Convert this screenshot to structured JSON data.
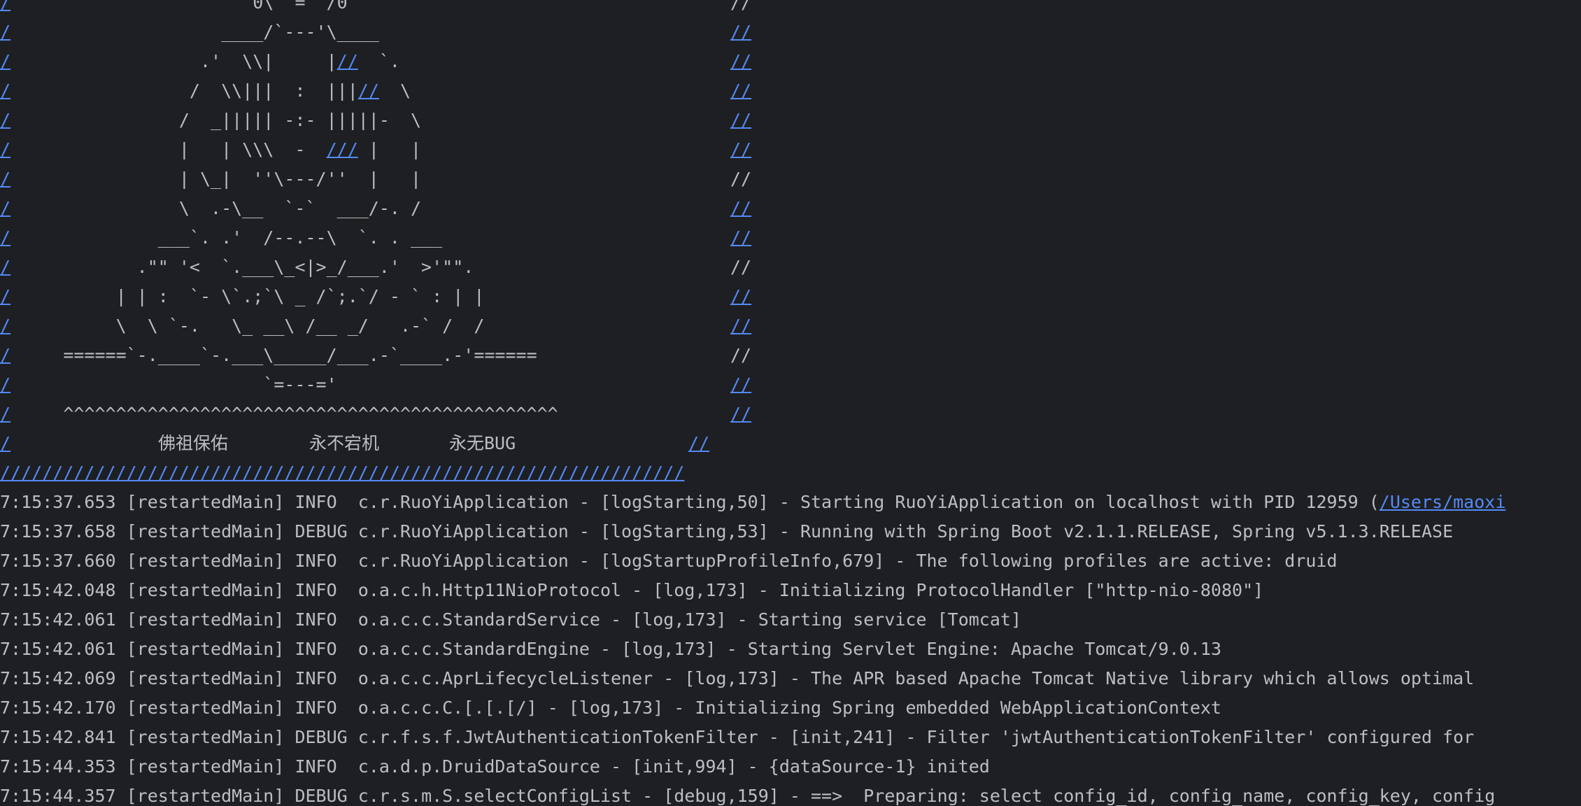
{
  "colors": {
    "background": "#1e1f22",
    "text": "#bcbec4",
    "link": "#548af7"
  },
  "banner": {
    "lines": [
      {
        "prefix": "/",
        "art": "                  0\\  =  /0                   ",
        "suffix": "//",
        "suffix_link": false,
        "prefix_link": true
      },
      {
        "prefix": "/",
        "art": "               ____/`---'\\____               ",
        "suffix": "//",
        "suffix_link": true,
        "prefix_link": true
      },
      {
        "prefix": "/",
        "art": "             .'  \\\\|     |",
        "mid_link": "//",
        "art_after": "  `.             ",
        "suffix": "//",
        "suffix_link": true,
        "prefix_link": true
      },
      {
        "prefix": "/",
        "art": "            /  \\\\|||  :  |||",
        "mid_link": "//",
        "art_after": "  \\            ",
        "suffix": "//",
        "suffix_link": true,
        "prefix_link": true
      },
      {
        "prefix": "/",
        "art": "           /  _||||| -:- |||||-  \\           ",
        "suffix": "//",
        "suffix_link": true,
        "prefix_link": true
      },
      {
        "prefix": "/",
        "art": "           |   | \\\\\\  -  ",
        "mid_link": "///",
        "art_after": " |   |           ",
        "suffix": "//",
        "suffix_link": true,
        "prefix_link": true
      },
      {
        "prefix": "/",
        "art": "           | \\_|  ''\\---/''  |   |           ",
        "suffix": "//",
        "suffix_link": false,
        "prefix_link": true
      },
      {
        "prefix": "/",
        "art": "           \\  .-\\__  `-`  ___/-. /           ",
        "suffix": "//",
        "suffix_link": true,
        "prefix_link": true
      },
      {
        "prefix": "/",
        "art": "         ___`. .'  /--.--\\  `. . ___         ",
        "suffix": "//",
        "suffix_link": true,
        "prefix_link": true
      },
      {
        "prefix": "/",
        "art": "       .\"\" '<  `.___\\_<|>_/___.'  >'\"\".       ",
        "suffix": "//",
        "suffix_link": false,
        "prefix_link": true
      },
      {
        "prefix": "/",
        "art": "     | | :  `- \\`.;`\\ _ /`;.`/ - ` : | |     ",
        "suffix": "//",
        "suffix_link": true,
        "prefix_link": true
      },
      {
        "prefix": "/",
        "art": "     \\  \\ `-.   \\_ __\\ /__ _/   .-` /  /     ",
        "suffix": "//",
        "suffix_link": true,
        "prefix_link": true
      },
      {
        "prefix": "/",
        "art": "======`-.____`-.___\\_____/___.-`____.-'======",
        "suffix": "//",
        "suffix_link": false,
        "prefix_link": true
      },
      {
        "prefix": "/",
        "art": "                   `=---='                    ",
        "suffix": "//",
        "suffix_link": true,
        "prefix_link": true
      },
      {
        "prefix": "/",
        "art": "^^^^^^^^^^^^^^^^^^^^^^^^^^^^^^^^^^^^^^^^^^^^^^^",
        "suffix": "//",
        "suffix_link": true,
        "prefix_link": true
      }
    ],
    "blessing": {
      "prefix": "/",
      "words": [
        "佛祖保佑",
        "永不宕机",
        "永无BUG"
      ],
      "suffix": "//"
    },
    "border": "/////////////////////////////////////////////////////////////////"
  },
  "log": [
    {
      "time": "7:15:37.653",
      "thread": "[restartedMain]",
      "level": "INFO ",
      "logger": "c.r.RuoYiApplication",
      "method": "[logStarting,50]",
      "message": "Starting RuoYiApplication on localhost with PID 12959 (",
      "link": "/Users/maoxi"
    },
    {
      "time": "7:15:37.658",
      "thread": "[restartedMain]",
      "level": "DEBUG",
      "logger": "c.r.RuoYiApplication",
      "method": "[logStarting,53]",
      "message": "Running with Spring Boot v2.1.1.RELEASE, Spring v5.1.3.RELEASE"
    },
    {
      "time": "7:15:37.660",
      "thread": "[restartedMain]",
      "level": "INFO ",
      "logger": "c.r.RuoYiApplication",
      "method": "[logStartupProfileInfo,679]",
      "message": "The following profiles are active: druid"
    },
    {
      "time": "7:15:42.048",
      "thread": "[restartedMain]",
      "level": "INFO ",
      "logger": "o.a.c.h.Http11NioProtocol",
      "method": "[log,173]",
      "message": "Initializing ProtocolHandler [\"http-nio-8080\"]"
    },
    {
      "time": "7:15:42.061",
      "thread": "[restartedMain]",
      "level": "INFO ",
      "logger": "o.a.c.c.StandardService",
      "method": "[log,173]",
      "message": "Starting service [Tomcat]"
    },
    {
      "time": "7:15:42.061",
      "thread": "[restartedMain]",
      "level": "INFO ",
      "logger": "o.a.c.c.StandardEngine",
      "method": "[log,173]",
      "message": "Starting Servlet Engine: Apache Tomcat/9.0.13"
    },
    {
      "time": "7:15:42.069",
      "thread": "[restartedMain]",
      "level": "INFO ",
      "logger": "o.a.c.c.AprLifecycleListener",
      "method": "[log,173]",
      "message": "The APR based Apache Tomcat Native library which allows optimal"
    },
    {
      "time": "7:15:42.170",
      "thread": "[restartedMain]",
      "level": "INFO ",
      "logger": "o.a.c.c.C.[.[.[/]",
      "method": "[log,173]",
      "message": "Initializing Spring embedded WebApplicationContext"
    },
    {
      "time": "7:15:42.841",
      "thread": "[restartedMain]",
      "level": "DEBUG",
      "logger": "c.r.f.s.f.JwtAuthenticationTokenFilter",
      "method": "[init,241]",
      "message": "Filter 'jwtAuthenticationTokenFilter' configured for"
    },
    {
      "time": "7:15:44.353",
      "thread": "[restartedMain]",
      "level": "INFO ",
      "logger": "c.a.d.p.DruidDataSource",
      "method": "[init,994]",
      "message": "{dataSource-1} inited"
    },
    {
      "time": "7:15:44.357",
      "thread": "[restartedMain]",
      "level": "DEBUG",
      "logger": "c.r.s.m.S.selectConfigList",
      "method": "[debug,159]",
      "message": "==>  Preparing: select config_id, config_name, config_key, config"
    }
  ]
}
